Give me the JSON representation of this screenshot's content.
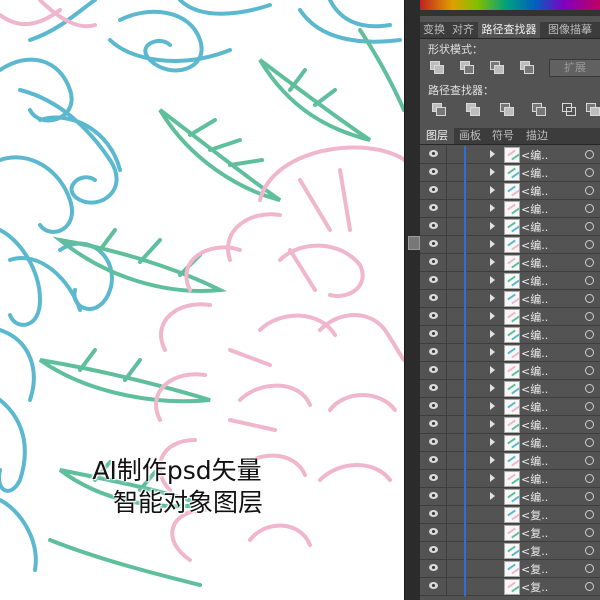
{
  "panel": {
    "tabs": [
      "变换",
      "对齐",
      "路径查找器",
      "图像描摹"
    ],
    "active_tab": "路径查找器",
    "shape_modes_label": "形状模式：",
    "expand_label": "扩展",
    "pathfinder_label": "路径查找器：",
    "layers_tabs": [
      "图层",
      "画板",
      "符号",
      "描边"
    ],
    "active_layers_tab": "图层"
  },
  "layers": [
    {
      "name": "<编..",
      "expandable": true
    },
    {
      "name": "<编..",
      "expandable": true
    },
    {
      "name": "<编..",
      "expandable": true
    },
    {
      "name": "<编..",
      "expandable": true
    },
    {
      "name": "<编..",
      "expandable": true
    },
    {
      "name": "<编..",
      "expandable": true
    },
    {
      "name": "<编..",
      "expandable": true
    },
    {
      "name": "<编..",
      "expandable": true
    },
    {
      "name": "<编..",
      "expandable": true
    },
    {
      "name": "<编..",
      "expandable": true
    },
    {
      "name": "<编..",
      "expandable": true
    },
    {
      "name": "<编..",
      "expandable": true
    },
    {
      "name": "<编..",
      "expandable": true
    },
    {
      "name": "<编..",
      "expandable": true
    },
    {
      "name": "<编..",
      "expandable": true
    },
    {
      "name": "<编..",
      "expandable": true
    },
    {
      "name": "<编..",
      "expandable": true
    },
    {
      "name": "<编..",
      "expandable": true
    },
    {
      "name": "<编..",
      "expandable": true
    },
    {
      "name": "<编..",
      "expandable": true
    },
    {
      "name": "<复..",
      "expandable": false
    },
    {
      "name": "<复..",
      "expandable": false
    },
    {
      "name": "<复..",
      "expandable": false
    },
    {
      "name": "<复..",
      "expandable": false
    },
    {
      "name": "<复..",
      "expandable": false
    }
  ],
  "caption": {
    "line1": "AI制作psd矢量",
    "line2": "智能对象图层"
  },
  "colors": {
    "panel_bg": "#535353",
    "layer_bar": "#2d6fd6",
    "art_blue": "#5bb8cf",
    "art_green": "#5fbf9c",
    "art_pink": "#f0b6cc"
  }
}
